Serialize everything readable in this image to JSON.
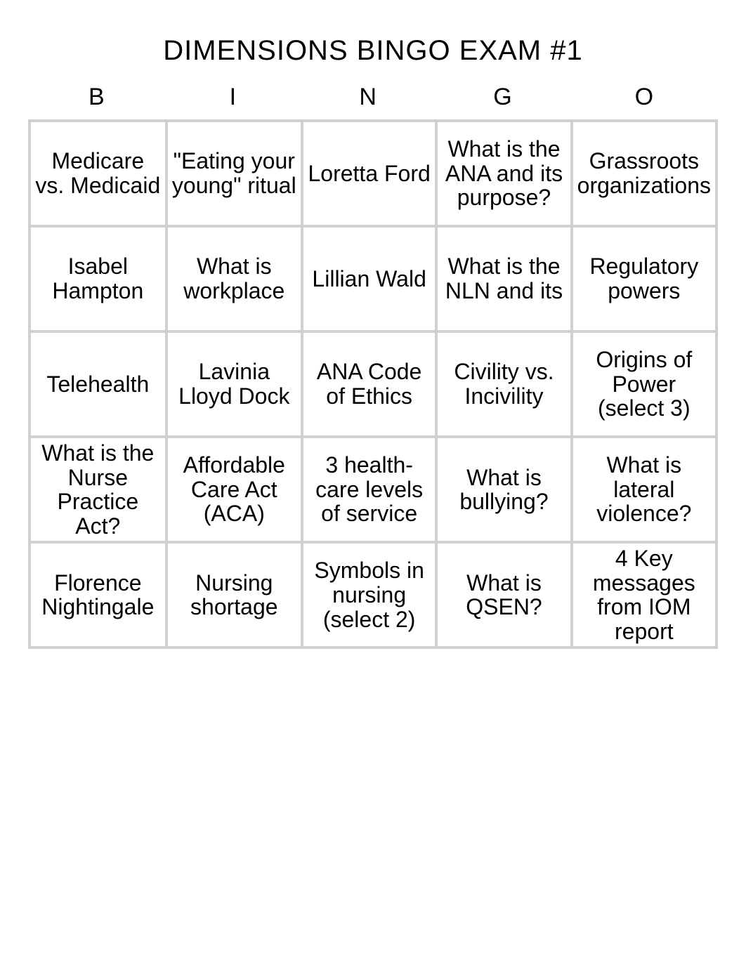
{
  "title": "DIMENSIONS BINGO EXAM #1",
  "headers": [
    "B",
    "I",
    "N",
    "G",
    "O"
  ],
  "rows": [
    [
      {
        "text": "Medicare vs. Medicaid"
      },
      {
        "text": "\"Eating your young\" ritual"
      },
      {
        "text": "Loretta Ford"
      },
      {
        "text": "What is the ANA and its purpose?"
      },
      {
        "text": "Grassroots organizations",
        "size": "small"
      }
    ],
    [
      {
        "text": "Isabel Hampton"
      },
      {
        "text": "What is workplace"
      },
      {
        "text": "Lillian Wald"
      },
      {
        "text": "What is the NLN and its"
      },
      {
        "text": "Regulatory powers"
      }
    ],
    [
      {
        "text": "Telehealth"
      },
      {
        "text": "Lavinia Lloyd Dock"
      },
      {
        "text": "ANA Code of Ethics"
      },
      {
        "text": "Civility vs. Incivility"
      },
      {
        "text": "Origins of Power (select 3)"
      }
    ],
    [
      {
        "text": "What is the Nurse Practice Act?"
      },
      {
        "text": "Affordable Care Act (ACA)"
      },
      {
        "text": "3 health-care levels of service"
      },
      {
        "text": "What is bullying?"
      },
      {
        "text": "What is lateral violence?"
      }
    ],
    [
      {
        "text": "Florence Nightingale",
        "size": "small"
      },
      {
        "text": "Nursing shortage"
      },
      {
        "text": "Symbols in nursing (select 2)"
      },
      {
        "text": "What is QSEN?"
      },
      {
        "text": "4 Key messages from IOM report",
        "size": "small"
      }
    ]
  ]
}
